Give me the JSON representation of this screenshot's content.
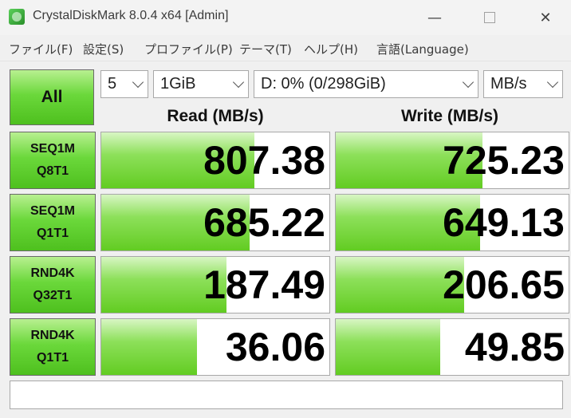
{
  "window": {
    "title": "CrystalDiskMark 8.0.4 x64 [Admin]",
    "minimize": "—",
    "close": "✕"
  },
  "menu": [
    "ファイル(F)",
    "設定(S)",
    "プロファイル(P)",
    "テーマ(T)",
    "ヘルプ(H)",
    "言語(Language)"
  ],
  "controls": {
    "all_label": "All",
    "count": "5",
    "size": "1GiB",
    "drive": "D: 0% (0/298GiB)",
    "unit": "MB/s"
  },
  "headers": {
    "read": "Read (MB/s)",
    "write": "Write (MB/s)"
  },
  "tests": [
    {
      "line1": "SEQ1M",
      "line2": "Q8T1",
      "read": "807.38",
      "write": "725.23",
      "read_fill": 0.67,
      "write_fill": 0.63
    },
    {
      "line1": "SEQ1M",
      "line2": "Q1T1",
      "read": "685.22",
      "write": "649.13",
      "read_fill": 0.65,
      "write_fill": 0.62
    },
    {
      "line1": "RND4K",
      "line2": "Q32T1",
      "read": "187.49",
      "write": "206.65",
      "read_fill": 0.55,
      "write_fill": 0.55
    },
    {
      "line1": "RND4K",
      "line2": "Q1T1",
      "read": "36.06",
      "write": "49.85",
      "read_fill": 0.42,
      "write_fill": 0.45
    }
  ],
  "comment": ""
}
